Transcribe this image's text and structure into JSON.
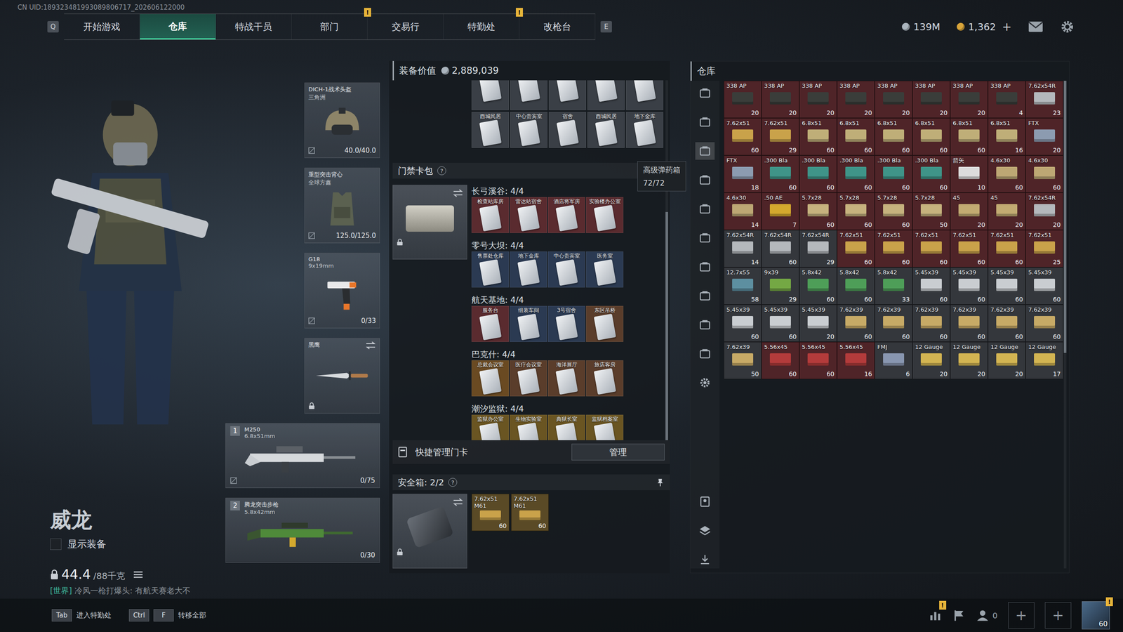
{
  "uid": "CN UID:189323481993089806717_202606122000",
  "nav": {
    "prev_key": "Q",
    "next_key": "E",
    "tabs": [
      {
        "label": "开始游戏",
        "selected": false,
        "alert": ""
      },
      {
        "label": "仓库",
        "selected": true,
        "alert": ""
      },
      {
        "label": "特战干员",
        "selected": false,
        "alert": ""
      },
      {
        "label": "部门",
        "selected": false,
        "alert": "!"
      },
      {
        "label": "交易行",
        "selected": false,
        "alert": ""
      },
      {
        "label": "特勤处",
        "selected": false,
        "alert": "!"
      },
      {
        "label": "改枪台",
        "selected": false,
        "alert": ""
      }
    ]
  },
  "currencies": [
    {
      "value": "139M",
      "add": "",
      "color": "#aab4bd"
    },
    {
      "value": "1,362",
      "add": "+",
      "color": "#d9a53a"
    }
  ],
  "operator": {
    "name": "威龙",
    "show_gear": {
      "label": "显示装备",
      "checked": false
    },
    "weight": "44.4",
    "weight_max": "/88千克"
  },
  "chat": {
    "channel": "[世界]",
    "text": "冷风一枪打爆头: 有航天赛老大不"
  },
  "gear_slots": [
    {
      "kind": "helmet",
      "name": "DICH-1战术头盔",
      "sub": "三角洲",
      "value": "40.0/40.0",
      "uninsured": true,
      "locked": false,
      "swap": false
    },
    {
      "kind": "armor",
      "name": "重型突击背心",
      "sub": "全球方鑫",
      "value": "125.0/125.0",
      "uninsured": true,
      "locked": false,
      "swap": false
    },
    {
      "kind": "pistol",
      "name": "G18",
      "sub": "9x19mm",
      "value": "0/33",
      "uninsured": true,
      "locked": false,
      "swap": false
    },
    {
      "kind": "knife",
      "name": "黑鹰",
      "sub": "",
      "value": "",
      "uninsured": false,
      "locked": true,
      "swap": true
    }
  ],
  "weapons": [
    {
      "index": "1",
      "kind": "mg",
      "name": "M250",
      "caliber": "6.8x51mm",
      "ammo": "0/75",
      "uninsured": true
    },
    {
      "index": "2",
      "kind": "rifle",
      "name": "腾龙突击步枪",
      "caliber": "5.8x42mm",
      "ammo": "0/30",
      "uninsured": false
    }
  ],
  "loadout_value": {
    "label": "装备价值",
    "value": "2,889,039"
  },
  "container_cards": [
    {
      "label": "",
      "bg": "#3a3f46"
    },
    {
      "label": "",
      "bg": "#3a3f46"
    },
    {
      "label": "",
      "bg": "#3a3f46"
    },
    {
      "label": "",
      "bg": "#3a3f46"
    },
    {
      "label": "",
      "bg": "#3a3f46"
    },
    {
      "label": "西城民居",
      "bg": "#3a3f46"
    },
    {
      "label": "中心贵宾室",
      "bg": "#3a3f46"
    },
    {
      "label": "宿舍",
      "bg": "#3a3f46"
    },
    {
      "label": "西城民居",
      "bg": "#3a3f46"
    },
    {
      "label": "地下金库",
      "bg": "#3a3f46"
    }
  ],
  "keycards": {
    "title": "门禁卡包",
    "help": "?",
    "maps": [
      {
        "name": "长弓溪谷",
        "count": "4/4",
        "cards": [
          {
            "label": "检查站库房",
            "bg": "#5a2b2f"
          },
          {
            "label": "雷达站宿舍",
            "bg": "#5a2b2f"
          },
          {
            "label": "酒店将军房",
            "bg": "#5a2b2f"
          },
          {
            "label": "实验楼办公室",
            "bg": "#5a2b2f"
          }
        ]
      },
      {
        "name": "零号大坝",
        "count": "4/4",
        "cards": [
          {
            "label": "售票处仓库",
            "bg": "#2b3a52"
          },
          {
            "label": "地下金库",
            "bg": "#2b3a52"
          },
          {
            "label": "中心贵宾室",
            "bg": "#2b3a52"
          },
          {
            "label": "医务室",
            "bg": "#2b3a52"
          }
        ]
      },
      {
        "name": "航天基地",
        "count": "4/4",
        "cards": [
          {
            "label": "服务台",
            "bg": "#5a2b2f"
          },
          {
            "label": "组装车间",
            "bg": "#2b3a52"
          },
          {
            "label": "3号宿舍",
            "bg": "#2b3a52"
          },
          {
            "label": "东区吊桥",
            "bg": "#5a3d2b"
          }
        ]
      },
      {
        "name": "巴克什",
        "count": "4/4",
        "cards": [
          {
            "label": "总裁会议室",
            "bg": "#6a4a22"
          },
          {
            "label": "医疗会议室",
            "bg": "#5a3d2b"
          },
          {
            "label": "海洋展厅",
            "bg": "#5a3d2b"
          },
          {
            "label": "旅店客房",
            "bg": "#5a3d2b"
          }
        ]
      },
      {
        "name": "潮汐监狱",
        "count": "4/4",
        "cards": [
          {
            "label": "监狱办公室",
            "bg": "#6a5522"
          },
          {
            "label": "生物实验室",
            "bg": "#6a5522"
          },
          {
            "label": "典狱长室",
            "bg": "#6a5522"
          },
          {
            "label": "监狱档案室",
            "bg": "#6a5522"
          }
        ]
      }
    ]
  },
  "tooltip": {
    "title": "高级弹药箱",
    "value": "72/72"
  },
  "quick_manage": {
    "label": "快捷管理门卡",
    "button": "管理"
  },
  "safe_box": {
    "label": "安全箱:",
    "count": "2/2",
    "help": "?",
    "items": [
      {
        "label": "7.62x51",
        "sub": "M61",
        "count": "60",
        "color": "#c9a24a",
        "bg": "#5a4a26"
      },
      {
        "label": "7.62x51",
        "sub": "M61",
        "count": "60",
        "color": "#c9a24a",
        "bg": "#5a4a26"
      }
    ]
  },
  "stash": {
    "title": "仓库",
    "side_tabs": [
      {
        "selected": false
      },
      {
        "selected": false
      },
      {
        "selected": true
      },
      {
        "selected": false
      },
      {
        "selected": false
      },
      {
        "selected": false
      },
      {
        "selected": false
      },
      {
        "selected": false
      },
      {
        "selected": false
      },
      {
        "selected": false
      }
    ],
    "rows": [
      [
        {
          "label": "338 AP",
          "count": "20",
          "color": "#3a3d3a",
          "bg": "#4f2428"
        },
        {
          "label": "338 AP",
          "count": "20",
          "color": "#3a3d3a",
          "bg": "#4f2428"
        },
        {
          "label": "338 AP",
          "count": "20",
          "color": "#3a3d3a",
          "bg": "#4f2428"
        },
        {
          "label": "338 AP",
          "count": "20",
          "color": "#3a3d3a",
          "bg": "#4f2428"
        },
        {
          "label": "338 AP",
          "count": "20",
          "color": "#3a3d3a",
          "bg": "#4f2428"
        },
        {
          "label": "338 AP",
          "count": "20",
          "color": "#3a3d3a",
          "bg": "#4f2428"
        },
        {
          "label": "338 AP",
          "count": "20",
          "color": "#3a3d3a",
          "bg": "#4f2428"
        },
        {
          "label": "338 AP",
          "count": "4",
          "color": "#3a3d3a",
          "bg": "#4f2428"
        },
        {
          "label": "7.62x54R",
          "count": "23",
          "color": "#b4b8bc",
          "bg": "#4f2428"
        }
      ],
      [
        {
          "label": "7.62x51",
          "count": "60",
          "color": "#c9a24a",
          "bg": "#4f2428"
        },
        {
          "label": "7.62x51",
          "count": "29",
          "color": "#c9a24a",
          "bg": "#4f2428"
        },
        {
          "label": "6.8x51",
          "count": "60",
          "color": "#bfae78",
          "bg": "#4f2428"
        },
        {
          "label": "6.8x51",
          "count": "60",
          "color": "#bfae78",
          "bg": "#4f2428"
        },
        {
          "label": "6.8x51",
          "count": "60",
          "color": "#bfae78",
          "bg": "#4f2428"
        },
        {
          "label": "6.8x51",
          "count": "60",
          "color": "#bfae78",
          "bg": "#4f2428"
        },
        {
          "label": "6.8x51",
          "count": "60",
          "color": "#bfae78",
          "bg": "#4f2428"
        },
        {
          "label": "6.8x51",
          "count": "16",
          "color": "#bfae78",
          "bg": "#4f2428"
        },
        {
          "label": "FTX",
          "count": "20",
          "color": "#8c9bb0",
          "bg": "#4f2428"
        }
      ],
      [
        {
          "label": "FTX",
          "count": "18",
          "color": "#8c9bb0",
          "bg": "#4f2428"
        },
        {
          "label": ".300 Bla",
          "count": "60",
          "color": "#3f9488",
          "bg": "#4f2428"
        },
        {
          "label": ".300 Bla",
          "count": "60",
          "color": "#3f9488",
          "bg": "#4f2428"
        },
        {
          "label": ".300 Bla",
          "count": "60",
          "color": "#3f9488",
          "bg": "#4f2428"
        },
        {
          "label": ".300 Bla",
          "count": "60",
          "color": "#3f9488",
          "bg": "#4f2428"
        },
        {
          "label": ".300 Bla",
          "count": "60",
          "color": "#3f9488",
          "bg": "#4f2428"
        },
        {
          "label": "箭矢",
          "count": "10",
          "color": "#dcdcdc",
          "bg": "#4f2428"
        },
        {
          "label": "4.6x30",
          "count": "60",
          "color": "#bda774",
          "bg": "#4f2428"
        },
        {
          "label": "4.6x30",
          "count": "60",
          "color": "#bda774",
          "bg": "#4f2428"
        }
      ],
      [
        {
          "label": "4.6x30",
          "count": "14",
          "color": "#bda774",
          "bg": "#4f2428"
        },
        {
          "label": ".50 AE",
          "count": "7",
          "color": "#d4a92e",
          "bg": "#4f2428"
        },
        {
          "label": "5.7x28",
          "count": "60",
          "color": "#c6b27e",
          "bg": "#4f2428"
        },
        {
          "label": "5.7x28",
          "count": "60",
          "color": "#c6b27e",
          "bg": "#4f2428"
        },
        {
          "label": "5.7x28",
          "count": "60",
          "color": "#c6b27e",
          "bg": "#4f2428"
        },
        {
          "label": "5.7x28",
          "count": "50",
          "color": "#c6b27e",
          "bg": "#4f2428"
        },
        {
          "label": "45",
          "count": "20",
          "color": "#c2ab72",
          "bg": "#4f2428"
        },
        {
          "label": "45",
          "count": "20",
          "color": "#c2ab72",
          "bg": "#4f2428"
        },
        {
          "label": "7.62x54R",
          "count": "20",
          "color": "#b4b8bc",
          "bg": "#4f2428"
        }
      ],
      [
        {
          "label": "7.62x54R",
          "count": "14",
          "color": "#b4b8bc",
          "bg": "#34373c"
        },
        {
          "label": "7.62x54R",
          "count": "60",
          "color": "#b4b8bc",
          "bg": "#34373c"
        },
        {
          "label": "7.62x54R",
          "count": "29",
          "color": "#b4b8bc",
          "bg": "#34373c"
        },
        {
          "label": "7.62x51",
          "count": "60",
          "color": "#c9a24a",
          "bg": "#4f2428"
        },
        {
          "label": "7.62x51",
          "count": "60",
          "color": "#c9a24a",
          "bg": "#4f2428"
        },
        {
          "label": "7.62x51",
          "count": "60",
          "color": "#c9a24a",
          "bg": "#4f2428"
        },
        {
          "label": "7.62x51",
          "count": "60",
          "color": "#c9a24a",
          "bg": "#4f2428"
        },
        {
          "label": "7.62x51",
          "count": "60",
          "color": "#c9a24a",
          "bg": "#4f2428"
        },
        {
          "label": "7.62x51",
          "count": "25",
          "color": "#c9a24a",
          "bg": "#4f2428"
        }
      ],
      [
        {
          "label": "12.7x55",
          "count": "58",
          "color": "#5d8fa0",
          "bg": "#34373c"
        },
        {
          "label": "9x39",
          "count": "29",
          "color": "#74a844",
          "bg": "#34373c"
        },
        {
          "label": "5.8x42",
          "count": "60",
          "color": "#4e9e58",
          "bg": "#34373c"
        },
        {
          "label": "5.8x42",
          "count": "60",
          "color": "#4e9e58",
          "bg": "#34373c"
        },
        {
          "label": "5.8x42",
          "count": "33",
          "color": "#4e9e58",
          "bg": "#34373c"
        },
        {
          "label": "5.45x39",
          "count": "60",
          "color": "#c9cdd1",
          "bg": "#34373c"
        },
        {
          "label": "5.45x39",
          "count": "60",
          "color": "#c9cdd1",
          "bg": "#34373c"
        },
        {
          "label": "5.45x39",
          "count": "60",
          "color": "#c9cdd1",
          "bg": "#34373c"
        },
        {
          "label": "5.45x39",
          "count": "60",
          "color": "#c9cdd1",
          "bg": "#34373c"
        }
      ],
      [
        {
          "label": "5.45x39",
          "count": "60",
          "color": "#c9cdd1",
          "bg": "#34373c"
        },
        {
          "label": "5.45x39",
          "count": "60",
          "color": "#c9cdd1",
          "bg": "#34373c"
        },
        {
          "label": "5.45x39",
          "count": "20",
          "color": "#c9cdd1",
          "bg": "#34373c"
        },
        {
          "label": "7.62x39",
          "count": "60",
          "color": "#c7aa66",
          "bg": "#34373c"
        },
        {
          "label": "7.62x39",
          "count": "60",
          "color": "#c7aa66",
          "bg": "#34373c"
        },
        {
          "label": "7.62x39",
          "count": "60",
          "color": "#c7aa66",
          "bg": "#34373c"
        },
        {
          "label": "7.62x39",
          "count": "60",
          "color": "#c7aa66",
          "bg": "#34373c"
        },
        {
          "label": "7.62x39",
          "count": "60",
          "color": "#c7aa66",
          "bg": "#34373c"
        },
        {
          "label": "7.62x39",
          "count": "60",
          "color": "#c7aa66",
          "bg": "#34373c"
        }
      ],
      [
        {
          "label": "7.62x39",
          "count": "50",
          "color": "#c7aa66",
          "bg": "#34373c"
        },
        {
          "label": "5.56x45",
          "count": "60",
          "color": "#b33b3b",
          "bg": "#4f2428"
        },
        {
          "label": "5.56x45",
          "count": "60",
          "color": "#b33b3b",
          "bg": "#4f2428"
        },
        {
          "label": "5.56x45",
          "count": "16",
          "color": "#b33b3b",
          "bg": "#4f2428"
        },
        {
          "label": "FMJ",
          "count": "6",
          "color": "#8896b0",
          "bg": "#34373c"
        },
        {
          "label": "12 Gauge",
          "count": "20",
          "color": "#d2b452",
          "bg": "#34373c"
        },
        {
          "label": "12 Gauge",
          "count": "20",
          "color": "#d2b452",
          "bg": "#34373c"
        },
        {
          "label": "12 Gauge",
          "count": "20",
          "color": "#d2b452",
          "bg": "#34373c"
        },
        {
          "label": "12 Gauge",
          "count": "17",
          "color": "#d2b452",
          "bg": "#34373c"
        }
      ]
    ]
  },
  "bottom": {
    "hotkeys": [
      {
        "keys": [
          "Tab"
        ],
        "label": "进入特勤处"
      },
      {
        "keys": [
          "Ctrl",
          "F"
        ],
        "label": "转移全部"
      }
    ],
    "stats_alert": "!",
    "friends": "0",
    "add_slots": [
      "+",
      "+"
    ],
    "avatar_alert": "!",
    "level": "60"
  }
}
